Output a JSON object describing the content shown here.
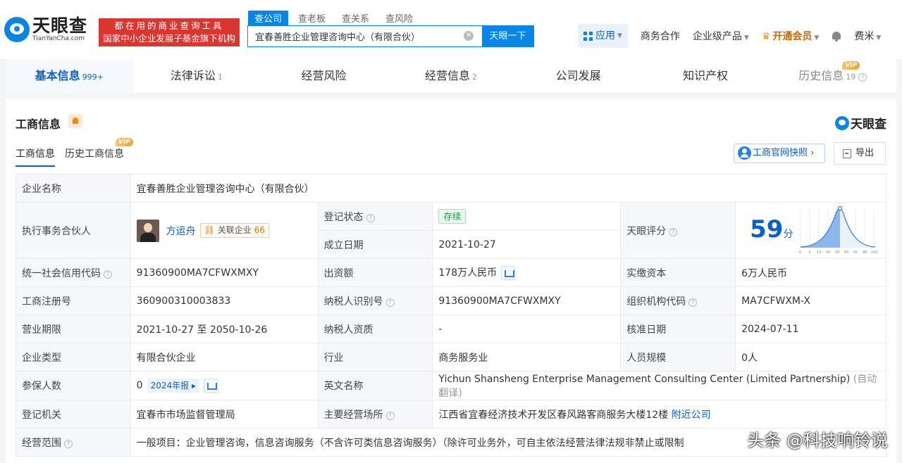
{
  "logo": {
    "cn": "天眼查",
    "en": "TianYanCha.com"
  },
  "promo": {
    "line1": "都在用的商业查询工具",
    "line2": "国家中小企业发展子基金旗下机构"
  },
  "search_tabs": [
    "查公司",
    "查老板",
    "查关系",
    "查风险"
  ],
  "search": {
    "value": "宜春善胜企业管理咨询中心（有限合伙）",
    "button": "天眼一下"
  },
  "topnav": {
    "app": "应用",
    "biz": "商务合作",
    "enterprise": "企业级产品",
    "vip": "开通会员",
    "user": "费米"
  },
  "main_tabs": [
    {
      "label": "基本信息",
      "count": "999+"
    },
    {
      "label": "法律诉讼",
      "count": "1"
    },
    {
      "label": "经营风险",
      "count": ""
    },
    {
      "label": "经营信息",
      "count": "2"
    },
    {
      "label": "公司发展",
      "count": ""
    },
    {
      "label": "知识产权",
      "count": ""
    },
    {
      "label": "历史信息",
      "count": "19"
    }
  ],
  "vip_label": "VIP",
  "section": {
    "title": "工商信息",
    "brand": "天眼查",
    "subtabs": [
      "工商信息",
      "历史工商信息"
    ],
    "site_btn": "工商官网快照",
    "export_btn": "导出"
  },
  "table": {
    "company_name_label": "企业名称",
    "company_name": "宜春善胜企业管理咨询中心（有限合伙）",
    "partner_label": "执行事务合伙人",
    "partner_name": "方运舟",
    "related_label": "关联企业",
    "related_count": "66",
    "status_label": "登记状态",
    "status": "存续",
    "est_date_label": "成立日期",
    "est_date": "2021-10-27",
    "score_label": "天眼评分",
    "score": "59",
    "score_unit": "分",
    "credit_code_label": "统一社会信用代码",
    "credit_code": "91360900MA7CFWXMXY",
    "capital_label": "出资额",
    "capital": "178万人民币",
    "paid_capital_label": "实缴资本",
    "paid_capital": "6万人民币",
    "reg_no_label": "工商注册号",
    "reg_no": "360900310003833",
    "tax_id_label": "纳税人识别号",
    "tax_id": "91360900MA7CFWXMXY",
    "org_code_label": "组织机构代码",
    "org_code": "MA7CFWXM-X",
    "term_label": "营业期限",
    "term": "2021-10-27 至 2050-10-26",
    "tax_quality_label": "纳税人资质",
    "tax_quality": "-",
    "approve_date_label": "核准日期",
    "approve_date": "2024-07-11",
    "type_label": "企业类型",
    "type": "有限合伙企业",
    "industry_label": "行业",
    "industry": "商务服务业",
    "staff_label": "人员规模",
    "staff": "0人",
    "insured_label": "参保人数",
    "insured": "0",
    "report": "2024年报",
    "en_name_label": "英文名称",
    "en_name": "Yichun Shansheng Enterprise Management Consulting Center (Limited Partnership)",
    "auto_translate": "(自动翻译)",
    "authority_label": "登记机关",
    "authority": "宜春市市场监督管理局",
    "address_label": "主要经营场所",
    "address": "江西省宜春经济技术开发区春风路客商服务大楼12楼",
    "nearby": "附近公司",
    "scope_label": "经营范围",
    "scope": "一般项目：企业管理咨询，信息咨询服务（不含许可类信息咨询服务）（除许可业务外，可自主依法经营法律法规非禁止或限制"
  },
  "score_chart": {
    "ticks": [
      "0",
      "3",
      "15",
      "35",
      "50",
      "65",
      "85",
      "98",
      "100"
    ]
  },
  "watermark": "头条 @科技响铃说"
}
